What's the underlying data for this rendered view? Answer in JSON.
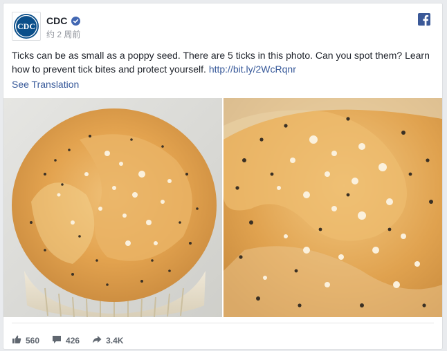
{
  "post": {
    "page_name": "CDC",
    "timestamp": "约 2 周前",
    "text_before_link": "Ticks can be as small as a poppy seed. There are 5 ticks in this photo. Can you spot them? Learn how to prevent tick bites and protect yourself. ",
    "link_text": "http://bit.ly/2WcRqnr",
    "see_translation": "See Translation",
    "avatar_text": "CDC"
  },
  "footer": {
    "likes": "560",
    "comments": "426",
    "shares": "3.4K"
  },
  "icons": {
    "verified": "verified-badge-icon",
    "facebook": "facebook-logo-icon",
    "like": "thumbs-up-icon",
    "comment": "comment-bubble-icon",
    "share": "share-arrow-icon"
  },
  "colors": {
    "link": "#365899",
    "facebook_blue": "#3b5998",
    "verified_blue": "#4267b2",
    "cdc_blue": "#0b4f8a"
  }
}
